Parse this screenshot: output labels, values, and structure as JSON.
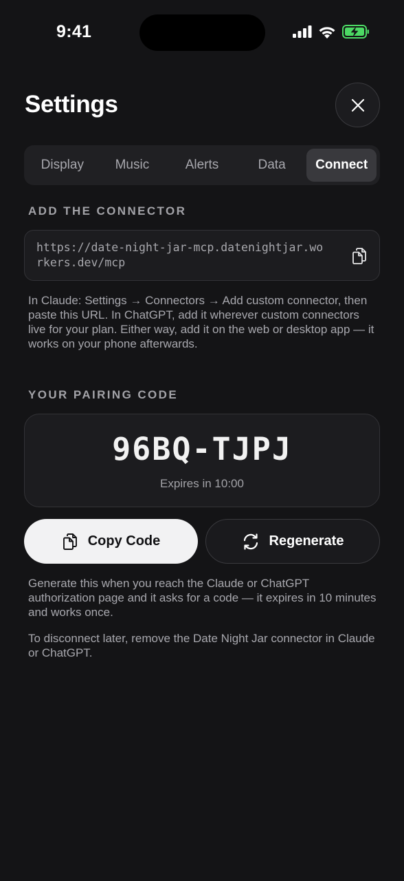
{
  "status_bar": {
    "time": "9:41"
  },
  "header": {
    "title": "Settings"
  },
  "tabs": [
    {
      "label": "Display"
    },
    {
      "label": "Music"
    },
    {
      "label": "Alerts"
    },
    {
      "label": "Data"
    },
    {
      "label": "Connect",
      "active": true
    }
  ],
  "connector": {
    "section_label": "ADD THE CONNECTOR",
    "url": "https://date-night-jar-mcp.datenightjar.workers.dev/mcp",
    "instructions": "In Claude: Settings → Connectors → Add custom connector, then paste this URL. In ChatGPT, add it wherever custom connectors live for your plan. Either way, add it on the web or desktop app — it works on your phone afterwards."
  },
  "pairing": {
    "section_label": "YOUR PAIRING CODE",
    "code": "96BQ-TJPJ",
    "expiry": "Expires in 10:00",
    "copy_label": "Copy Code",
    "regenerate_label": "Regenerate",
    "help_text": "Generate this when you reach the Claude or ChatGPT authorization page and it asks for a code — it expires in 10 minutes and works once.",
    "disconnect_text": "To disconnect later, remove the Date Night Jar connector in Claude or ChatGPT."
  },
  "colors": {
    "background": "#141416",
    "battery_green": "#4cd964"
  },
  "icons": [
    "signal-icon",
    "wifi-icon",
    "battery-charging-icon",
    "close-icon",
    "copy-icon",
    "refresh-icon"
  ]
}
